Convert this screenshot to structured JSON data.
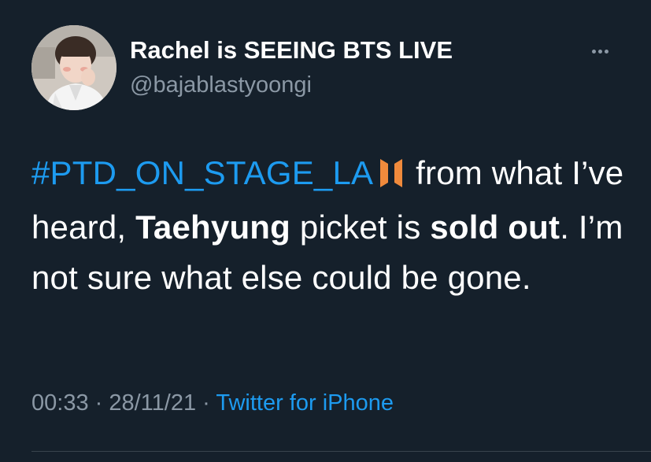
{
  "user": {
    "display_name": "Rachel is SEEING BTS LIVE",
    "handle": "@bajablastyoongi"
  },
  "tweet": {
    "hashtag": "#PTD_ON_STAGE_LA",
    "emoji": "bts-logo-emoji",
    "text_1": " from what I’ve heard, ",
    "bold_1": "Taehyung",
    "text_2": " picket is ",
    "bold_2": "sold out",
    "text_3": ". I’m not sure what else could be gone."
  },
  "meta": {
    "time": "00:33",
    "separator": " · ",
    "date": "28/11/21",
    "source": "Twitter for iPhone"
  },
  "icons": {
    "more": "more-horizontal-icon"
  },
  "colors": {
    "background": "#15202b",
    "link": "#1d9bf0",
    "muted": "#8b98a5",
    "text": "#ffffff",
    "emoji": "#f08a3c"
  }
}
